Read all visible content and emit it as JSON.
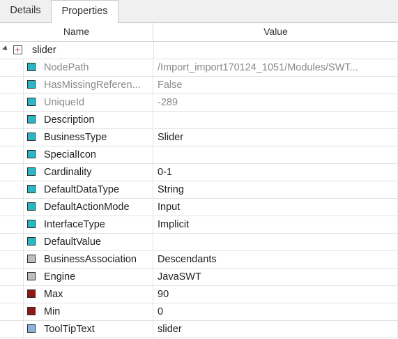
{
  "tabs": [
    {
      "label": "Details"
    },
    {
      "label": "Properties"
    }
  ],
  "columns": {
    "name": "Name",
    "value": "Value"
  },
  "root": {
    "label": "slider"
  },
  "colors": {
    "teal": "#2fb5c2",
    "gray": "#bdbdbd",
    "darkred": "#8b1a16",
    "lightblue": "#8db2dc"
  },
  "rows": [
    {
      "name": "NodePath",
      "value": "/Import_import170124_1051/Modules/SWT...",
      "color": "teal",
      "dim": true
    },
    {
      "name": "HasMissingReferen...",
      "value": "False",
      "color": "teal",
      "dim": true
    },
    {
      "name": "UniqueId",
      "value": "-289",
      "color": "teal",
      "dim": true
    },
    {
      "name": "Description",
      "value": "",
      "color": "teal",
      "dim": false
    },
    {
      "name": "BusinessType",
      "value": "Slider",
      "color": "teal",
      "dim": false
    },
    {
      "name": "SpecialIcon",
      "value": "",
      "color": "teal",
      "dim": false
    },
    {
      "name": "Cardinality",
      "value": "0-1",
      "color": "teal",
      "dim": false
    },
    {
      "name": "DefaultDataType",
      "value": "String",
      "color": "teal",
      "dim": false
    },
    {
      "name": "DefaultActionMode",
      "value": "Input",
      "color": "teal",
      "dim": false
    },
    {
      "name": "InterfaceType",
      "value": "Implicit",
      "color": "teal",
      "dim": false
    },
    {
      "name": "DefaultValue",
      "value": "",
      "color": "teal",
      "dim": false
    },
    {
      "name": "BusinessAssociation",
      "value": "Descendants",
      "color": "gray",
      "dim": false
    },
    {
      "name": "Engine",
      "value": "JavaSWT",
      "color": "gray",
      "dim": false
    },
    {
      "name": "Max",
      "value": "90",
      "color": "darkred",
      "dim": false
    },
    {
      "name": "Min",
      "value": "0",
      "color": "darkred",
      "dim": false
    },
    {
      "name": "ToolTipText",
      "value": "slider",
      "color": "lightblue",
      "dim": false
    }
  ]
}
